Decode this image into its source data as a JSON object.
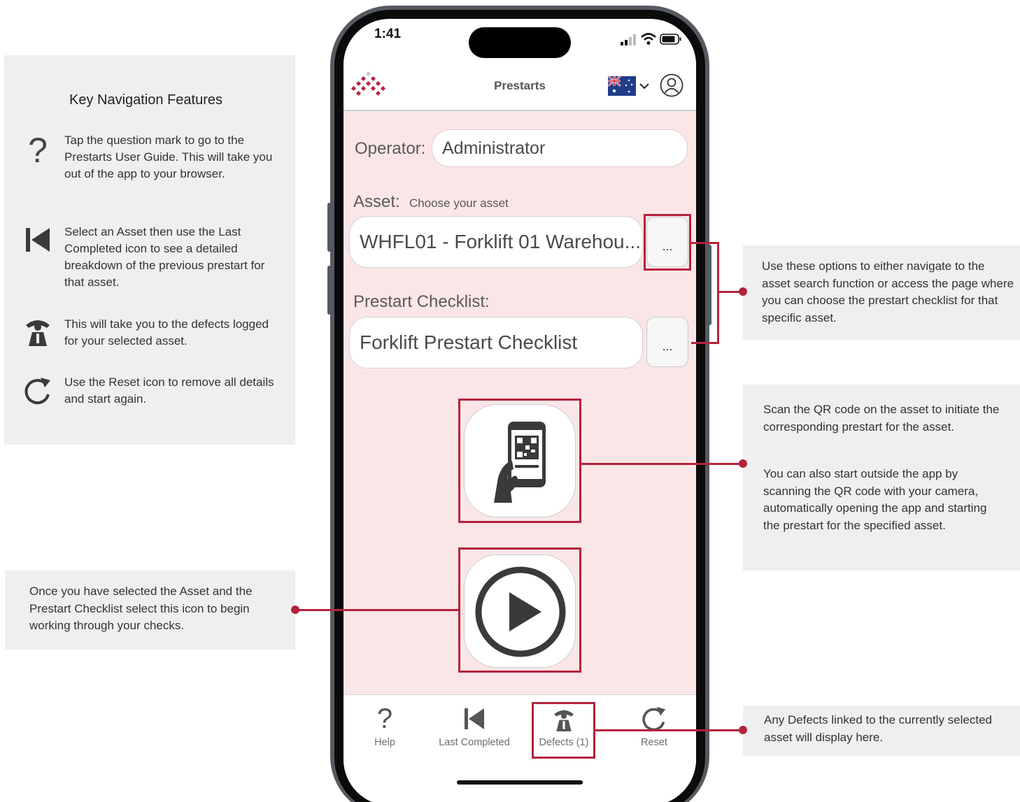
{
  "colors": {
    "accent": "#b3243b",
    "panel_bg": "#eeeff0",
    "screen_bg": "#fbe6e7"
  },
  "left_panel": {
    "title": "Key Navigation Features",
    "features": [
      {
        "icon": "question-mark-icon",
        "text": "Tap the question mark to go to the Prestarts User Guide. This will take you out of the app to your browser."
      },
      {
        "icon": "skip-back-icon",
        "text": "Select an Asset then use the Last Completed icon to see a detailed breakdown of the previous prestart for that asset."
      },
      {
        "icon": "defects-icon",
        "text": "This will take you to the defects logged for your selected asset."
      },
      {
        "icon": "reset-icon",
        "text": "Use the Reset icon to remove all details and start again."
      }
    ]
  },
  "callouts": {
    "start": "Once you have selected the Asset and the Prestart Checklist select this icon to begin working through your checks.",
    "options": "Use these options to either navigate to the asset search function or access the page where you can choose the prestart checklist for that specific asset.",
    "qr_1": "Scan the QR code on the asset to initiate the corresponding prestart for the asset.",
    "qr_2": "You can also start outside the app by scanning the QR code with your camera, automatically opening the app and starting the prestart for the specified asset.",
    "defects": "Any Defects linked to the currently selected asset will display here."
  },
  "phone": {
    "status_time": "1:41",
    "header_title": "Prestarts",
    "operator_label": "Operator:",
    "operator_value": "Administrator",
    "asset_label": "Asset:",
    "asset_hint": "Choose your asset",
    "asset_value": "WHFL01 - Forklift 01 Warehou...",
    "checklist_label": "Prestart Checklist:",
    "checklist_value": "Forklift Prestart Checklist",
    "more_label": "...",
    "tabs": [
      {
        "label": "Help",
        "icon": "question-mark-icon"
      },
      {
        "label": "Last Completed",
        "icon": "skip-back-icon"
      },
      {
        "label": "Defects (1)",
        "icon": "defects-icon"
      },
      {
        "label": "Reset",
        "icon": "reset-icon"
      }
    ]
  }
}
